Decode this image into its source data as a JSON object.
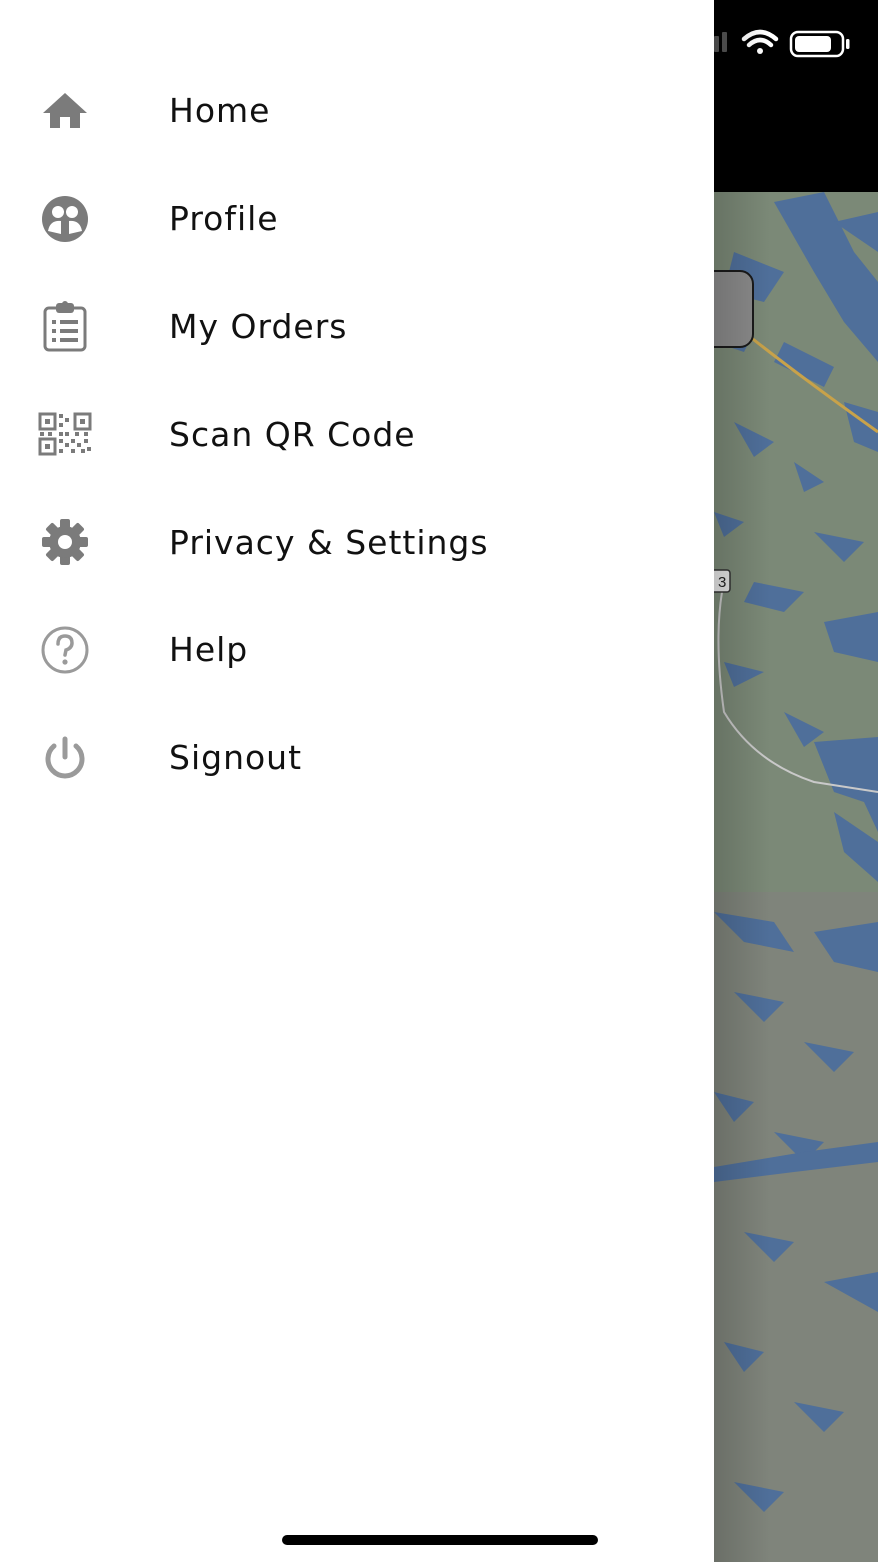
{
  "drawer": {
    "items": [
      {
        "label": "Home",
        "icon": "home-icon"
      },
      {
        "label": "Profile",
        "icon": "profile-icon"
      },
      {
        "label": "My Orders",
        "icon": "clipboard-list-icon"
      },
      {
        "label": "Scan QR Code",
        "icon": "qr-code-icon"
      },
      {
        "label": "Privacy & Settings",
        "icon": "gear-icon"
      },
      {
        "label": "Help",
        "icon": "help-circle-icon"
      },
      {
        "label": "Signout",
        "icon": "power-icon"
      }
    ]
  },
  "background_app": {
    "type": "map",
    "route_badge": "3"
  },
  "status_bar": {
    "icons": [
      "signal-icon",
      "wifi-icon",
      "battery-icon"
    ]
  },
  "colors": {
    "drawer_background": "#ffffff",
    "menu_text": "#111111",
    "menu_icon": "#7b7b7b",
    "map_water": "#4f6f9a",
    "map_land": "#7d8a78",
    "top_bar": "#000000"
  }
}
